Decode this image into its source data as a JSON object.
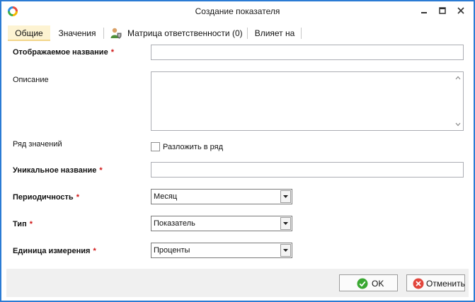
{
  "window": {
    "title": "Создание показателя",
    "accent_color": "#2b7bd4"
  },
  "tabs": [
    {
      "label": "Общие",
      "active": true
    },
    {
      "label": "Значения",
      "active": false
    },
    {
      "label": "Матрица ответственности (0)",
      "active": false,
      "icon": "user-shield-icon"
    },
    {
      "label": "Влияет на",
      "active": false
    }
  ],
  "form": {
    "display_name": {
      "label": "Отображаемое название",
      "required": "*",
      "value": ""
    },
    "description": {
      "label": "Описание",
      "value": ""
    },
    "series": {
      "label": "Ряд значений",
      "checkbox_label": "Разложить в ряд",
      "checked": false
    },
    "unique_name": {
      "label": "Уникальное название",
      "required": "*",
      "value": ""
    },
    "periodicity": {
      "label": "Периодичность",
      "required": "*",
      "value": "Месяц"
    },
    "type": {
      "label": "Тип",
      "required": "*",
      "value": "Показатель"
    },
    "unit": {
      "label": "Единица измерения",
      "required": "*",
      "value": "Проценты"
    }
  },
  "buttons": {
    "ok": {
      "label": "OK",
      "icon": "check-circle-icon",
      "color": "#3aa832"
    },
    "cancel": {
      "label": "Отменить",
      "icon": "cancel-circle-icon",
      "color": "#e2463c"
    }
  }
}
